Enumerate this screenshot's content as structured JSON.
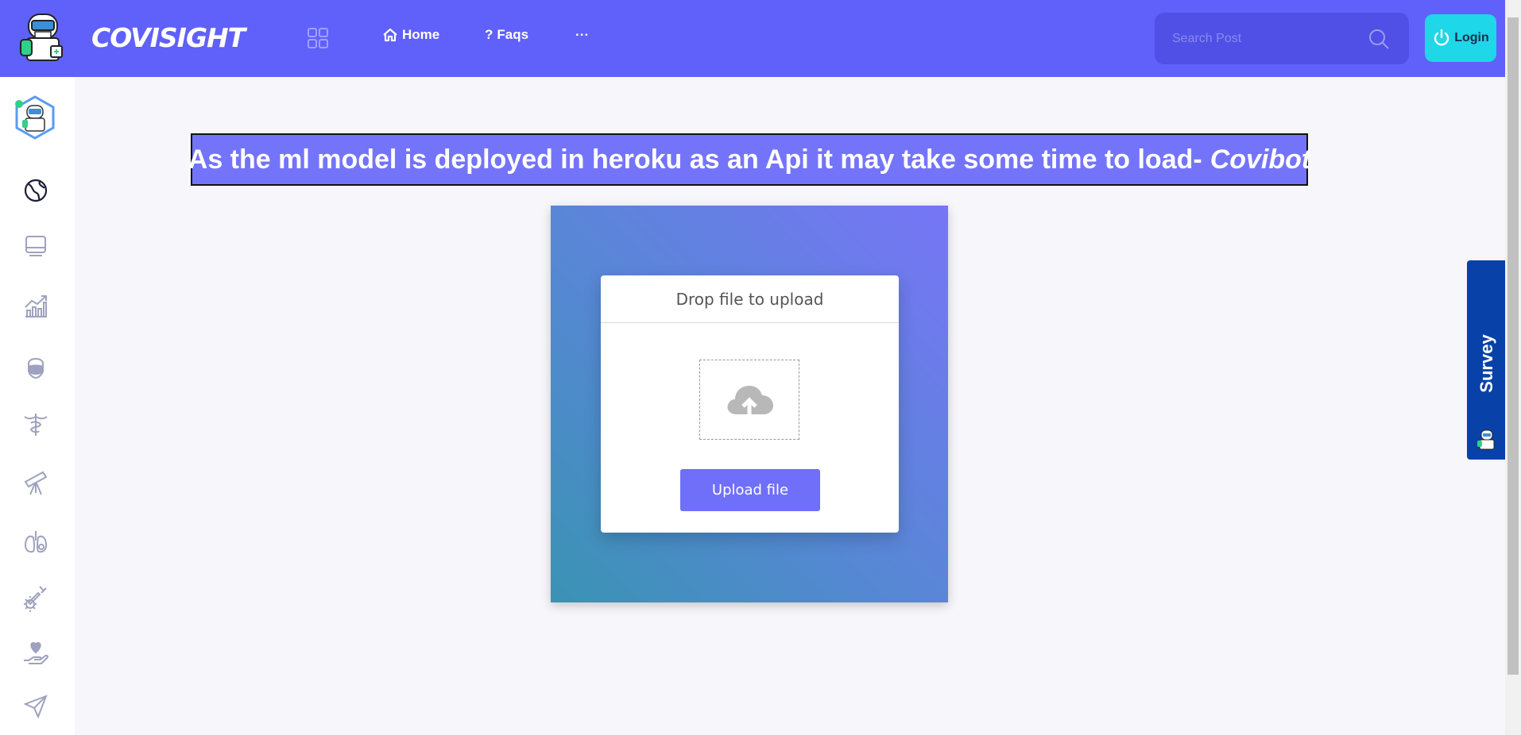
{
  "header": {
    "brand": "COVISIGHT",
    "nav": {
      "home": "Home",
      "faqs": "Faqs",
      "more": "..."
    },
    "search": {
      "placeholder": "Search Post"
    },
    "login_label": "Login",
    "colors": {
      "header_bg": "#6060fa",
      "search_bg": "#5050e6",
      "login_bg": "#1ed7e8"
    }
  },
  "sidebar": {
    "items": [
      {
        "icon": "globe-icon"
      },
      {
        "icon": "monitor-icon"
      },
      {
        "icon": "chart-trend-icon"
      },
      {
        "icon": "mask-face-icon"
      },
      {
        "icon": "caduceus-icon"
      },
      {
        "icon": "telescope-icon"
      },
      {
        "icon": "lungs-icon"
      },
      {
        "icon": "vaccine-icon"
      },
      {
        "icon": "heart-hand-icon"
      },
      {
        "icon": "send-icon"
      }
    ]
  },
  "banner": {
    "text": "As the ml model is deployed in heroku as an Api it may take some time to load-",
    "emphasis": "Covibot"
  },
  "upload": {
    "title": "Drop file to upload",
    "button_label": "Upload file",
    "accent": "#6f6ff9"
  },
  "survey": {
    "label": "Survey"
  }
}
